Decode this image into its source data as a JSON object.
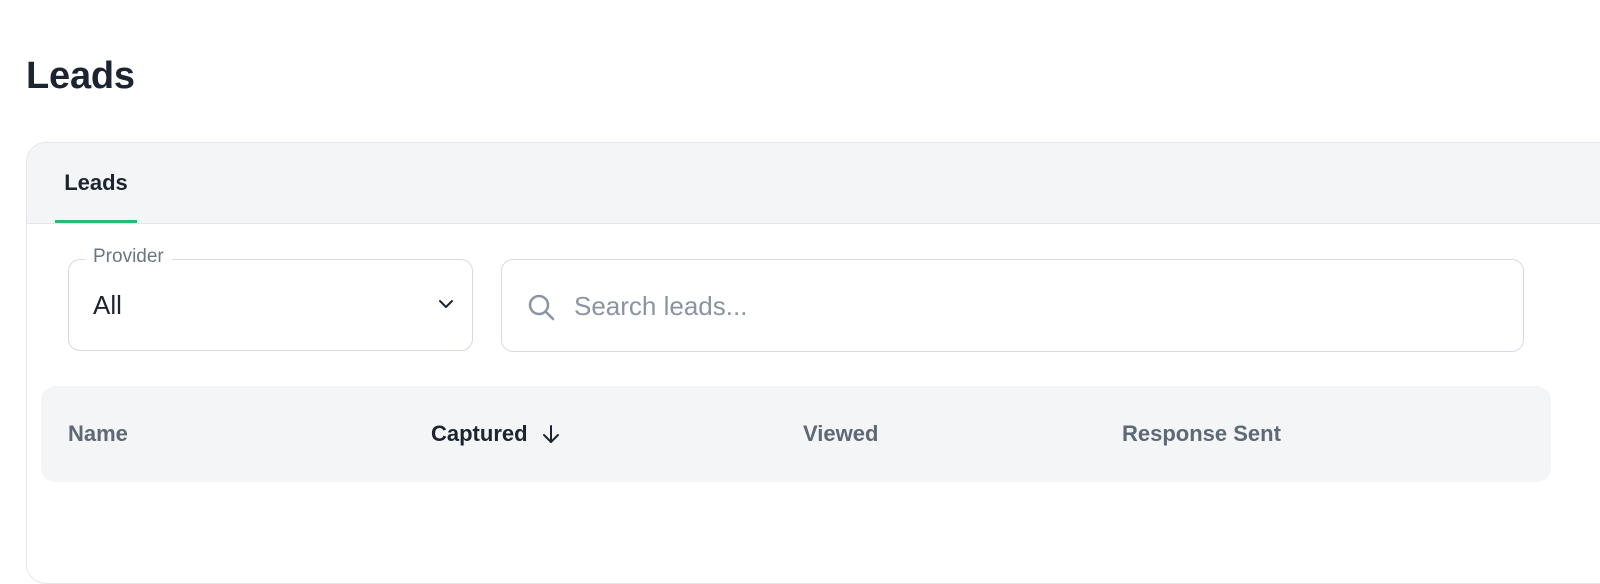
{
  "page": {
    "title": "Leads"
  },
  "tabs": [
    {
      "label": "Leads",
      "active": true
    }
  ],
  "filters": {
    "provider": {
      "label": "Provider",
      "value": "All"
    },
    "search": {
      "placeholder": "Search leads...",
      "value": ""
    }
  },
  "table": {
    "columns": [
      {
        "label": "Name",
        "sorted": false
      },
      {
        "label": "Captured",
        "sorted": true,
        "sort_direction": "desc"
      },
      {
        "label": "Viewed",
        "sorted": false
      },
      {
        "label": "Response Sent",
        "sorted": false
      }
    ],
    "rows": []
  },
  "colors": {
    "accent": "#2eb872",
    "heading": "#1b2430",
    "muted_header": "#5d6976",
    "panel_bg": "#f3f5f7"
  },
  "icons": {
    "dropdown": "chevron-down-icon",
    "search": "search-icon",
    "sort": "arrow-down-icon"
  }
}
